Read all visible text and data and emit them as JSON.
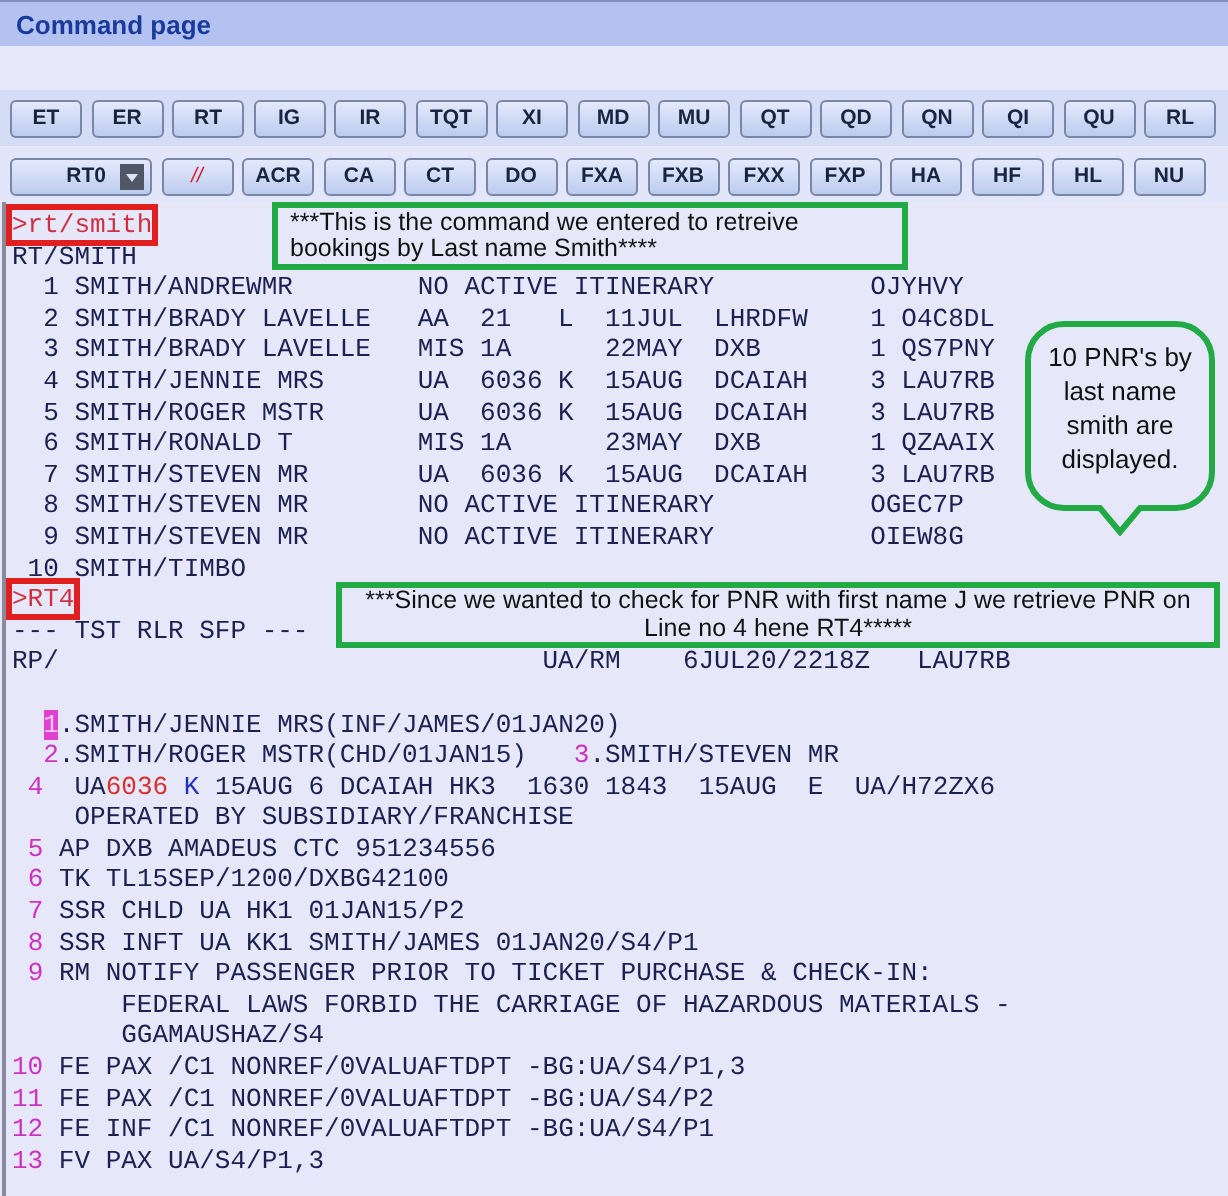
{
  "window": {
    "title": "Command page"
  },
  "toolbar_rows": [
    [
      {
        "label": "ET",
        "kind": "plain"
      },
      {
        "label": "ER",
        "kind": "plain"
      },
      {
        "label": "RT",
        "kind": "plain"
      },
      {
        "label": "IG",
        "kind": "plain"
      },
      {
        "label": "IR",
        "kind": "plain"
      },
      {
        "label": "TQT",
        "kind": "plain"
      },
      {
        "label": "XI",
        "kind": "plain"
      },
      {
        "label": "MD",
        "kind": "plain"
      },
      {
        "label": "MU",
        "kind": "plain"
      },
      {
        "label": "QT",
        "kind": "plain"
      },
      {
        "label": "QD",
        "kind": "plain"
      },
      {
        "label": "QN",
        "kind": "plain"
      },
      {
        "label": "QI",
        "kind": "plain"
      },
      {
        "label": "QU",
        "kind": "plain"
      },
      {
        "label": "RL",
        "kind": "plain"
      }
    ],
    [
      {
        "label": "RT0",
        "kind": "dropdown"
      },
      {
        "label": "//",
        "kind": "danger"
      },
      {
        "label": "ACR",
        "kind": "plain"
      },
      {
        "label": "CA",
        "kind": "plain"
      },
      {
        "label": "CT",
        "kind": "plain"
      },
      {
        "label": "DO",
        "kind": "plain"
      },
      {
        "label": "FXA",
        "kind": "plain"
      },
      {
        "label": "FXB",
        "kind": "plain"
      },
      {
        "label": "FXX",
        "kind": "plain"
      },
      {
        "label": "FXP",
        "kind": "plain"
      },
      {
        "label": "HA",
        "kind": "plain"
      },
      {
        "label": "HF",
        "kind": "plain"
      },
      {
        "label": "HL",
        "kind": "plain"
      },
      {
        "label": "NU",
        "kind": "plain"
      }
    ]
  ],
  "terminal": {
    "command_1": ">rt/smith",
    "header": "RT/SMITH",
    "results": [
      "  1 SMITH/ANDREWMR        NO ACTIVE ITINERARY          OJYHVY",
      "  2 SMITH/BRADY LAVELLE   AA  21   L  11JUL  LHRDFW    1 O4C8DL",
      "  3 SMITH/BRADY LAVELLE   MIS 1A      22MAY  DXB       1 QS7PNY",
      "  4 SMITH/JENNIE MRS      UA  6036 K  15AUG  DCAIAH    3 LAU7RB",
      "  5 SMITH/ROGER MSTR      UA  6036 K  15AUG  DCAIAH    3 LAU7RB",
      "  6 SMITH/RONALD T        MIS 1A      23MAY  DXB       1 QZAAIX",
      "  7 SMITH/STEVEN MR       UA  6036 K  15AUG  DCAIAH    3 LAU7RB",
      "  8 SMITH/STEVEN MR       NO ACTIVE ITINERARY          OGEC7P",
      "  9 SMITH/STEVEN MR       NO ACTIVE ITINERARY          OIEW8G",
      " 10 SMITH/TIMBO"
    ],
    "command_2": ">RT4",
    "status_line": "--- TST RLR SFP ---",
    "rp_line": "RP/                               UA/RM    6JUL20/2218Z   LAU7RB",
    "passengers": [
      [
        {
          "num": "1",
          "text": ".SMITH/JENNIE MRS(INF/JAMES/01JAN20)",
          "selected": true
        }
      ],
      [
        {
          "num": "2",
          "text": ".SMITH/ROGER MSTR(CHD/01JAN15)",
          "selected": false
        },
        {
          "num": "3",
          "text": ".SMITH/STEVEN MR",
          "selected": false
        }
      ]
    ],
    "elements": [
      {
        "num": "4",
        "kind": "segment",
        "segments": [
          {
            "text": "UA",
            "kind": "plain"
          },
          {
            "text": "6036",
            "kind": "flight"
          },
          {
            "text": " K",
            "kind": "class"
          },
          {
            "text": " 15AUG 6 DCAIAH HK3  1630 1843  15AUG  E  UA/H72ZX6",
            "kind": "plain"
          }
        ],
        "continuation": [
          "OPERATED BY SUBSIDIARY/FRANCHISE"
        ]
      },
      {
        "num": "5",
        "kind": "plain",
        "segments": [
          {
            "text": "AP DXB AMADEUS CTC 951234556",
            "kind": "plain"
          }
        ]
      },
      {
        "num": "6",
        "kind": "plain",
        "segments": [
          {
            "text": "TK TL15SEP/1200/DXBG42100",
            "kind": "plain"
          }
        ]
      },
      {
        "num": "7",
        "kind": "plain",
        "segments": [
          {
            "text": "SSR CHLD UA HK1 01JAN15/P2",
            "kind": "plain"
          }
        ]
      },
      {
        "num": "8",
        "kind": "plain",
        "segments": [
          {
            "text": "SSR INFT UA KK1 SMITH/JAMES 01JAN20/S4/P1",
            "kind": "plain"
          }
        ]
      },
      {
        "num": "9",
        "kind": "remark",
        "segments": [
          {
            "text": "RM NOTIFY PASSENGER PRIOR TO TICKET PURCHASE & CHECK-IN:",
            "kind": "plain"
          }
        ],
        "continuation": [
          "FEDERAL LAWS FORBID THE CARRIAGE OF HAZARDOUS MATERIALS -",
          "GGAMAUSHAZ/S4"
        ]
      },
      {
        "num": "10",
        "kind": "plain",
        "segments": [
          {
            "text": "FE PAX /C1 NONREF/0VALUAFTDPT -BG:UA/S4/P1,3",
            "kind": "plain"
          }
        ]
      },
      {
        "num": "11",
        "kind": "plain",
        "segments": [
          {
            "text": "FE PAX /C1 NONREF/0VALUAFTDPT -BG:UA/S4/P2",
            "kind": "plain"
          }
        ]
      },
      {
        "num": "12",
        "kind": "plain",
        "segments": [
          {
            "text": "FE INF /C1 NONREF/0VALUAFTDPT -BG:UA/S4/P1",
            "kind": "plain"
          }
        ]
      },
      {
        "num": "13",
        "kind": "plain",
        "segments": [
          {
            "text": "FV PAX UA/S4/P1,3",
            "kind": "plain"
          }
        ]
      }
    ]
  },
  "annotations": [
    {
      "kind": "box",
      "text": "***This is the command we entered to retreive bookings by Last name Smith****"
    },
    {
      "kind": "bubble",
      "text": "10 PNR's by last name smith are displayed."
    },
    {
      "kind": "box_centered",
      "text": "***Since we wanted to check for PNR with first name J we retrieve PNR on Line no 4 hene RT4*****"
    }
  ]
}
